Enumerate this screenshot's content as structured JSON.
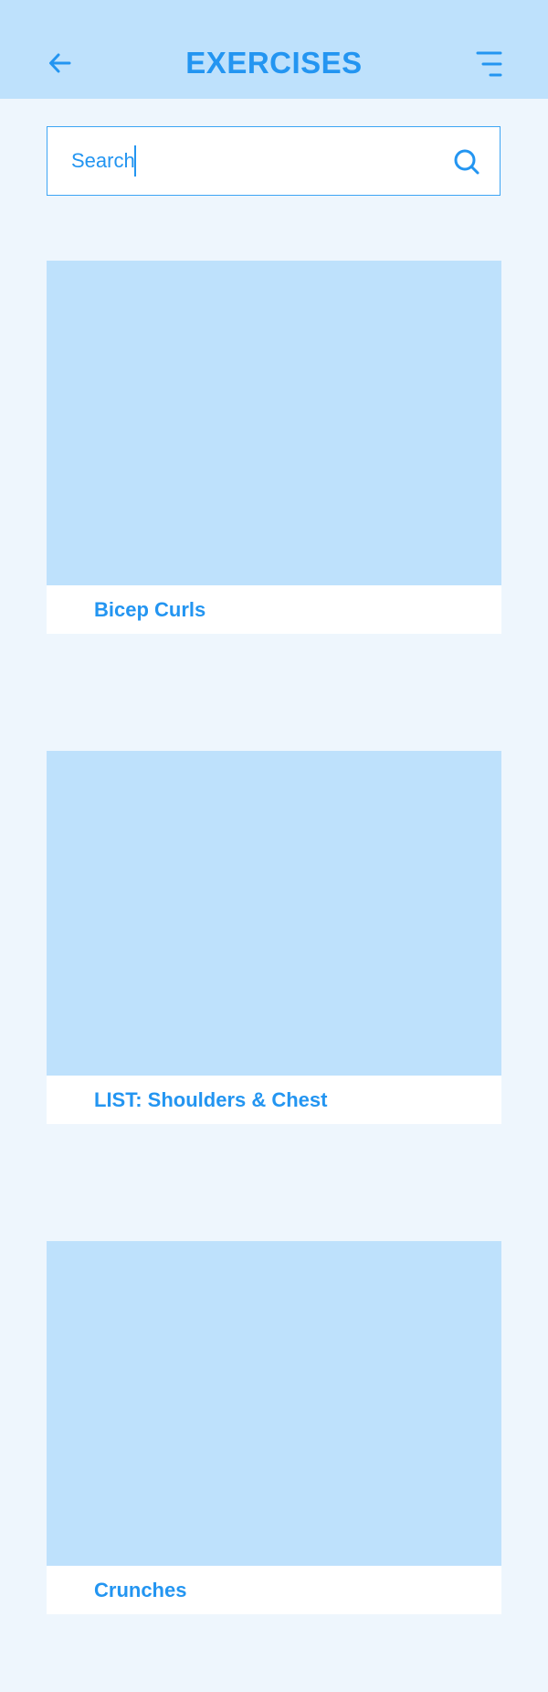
{
  "header": {
    "title": "EXERCISES",
    "back_icon": "arrow-left-icon",
    "menu_icon": "menu-icon"
  },
  "search": {
    "value": "Search",
    "icon": "search-icon"
  },
  "exercises": [
    {
      "title": "Bicep Curls"
    },
    {
      "title": "LIST: Shoulders & Chest"
    },
    {
      "title": "Crunches"
    }
  ],
  "colors": {
    "accent": "#2395F1",
    "header_bg": "#BEE1FC",
    "page_bg": "#EEF6FD",
    "card_image_bg": "#BEE1FC",
    "card_footer_bg": "#FFFFFF"
  }
}
